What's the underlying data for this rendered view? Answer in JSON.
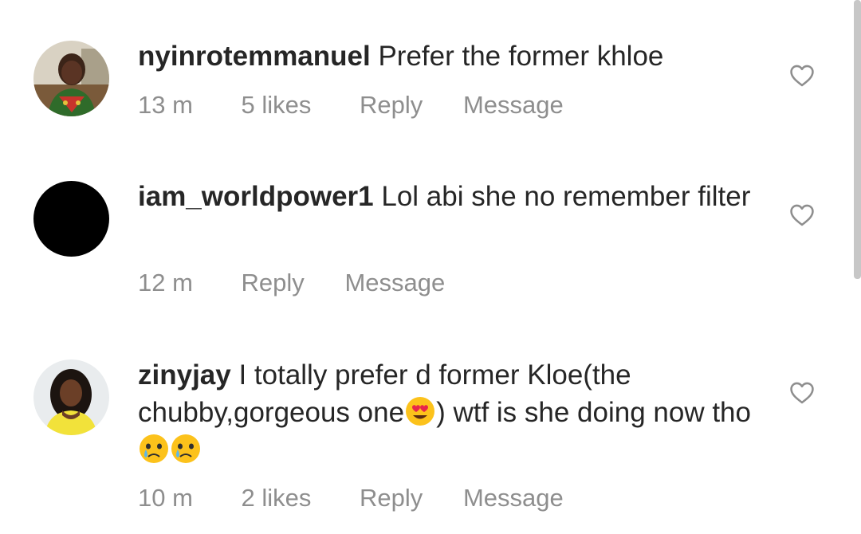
{
  "comments": [
    {
      "username": "nyinrotemmanuel",
      "text": " Prefer the former khloe",
      "time": "13 m",
      "likes": "5 likes",
      "reply": "Reply",
      "message": "Message",
      "avatar_icon": "profile-photo-woman"
    },
    {
      "username": "iam_worldpower1",
      "text": " Lol abi she no remember filter",
      "time": "12 m",
      "likes": "",
      "reply": "Reply",
      "message": "Message",
      "avatar_icon": "profile-photo-black"
    },
    {
      "username": "zinyjay",
      "text_part1": " I totally prefer d former Kloe(the chubby,gorgeous one",
      "text_part2": ") wtf is she doing now tho",
      "emoji_1": "heart-eyes-emoji",
      "emoji_2": "crying-emoji",
      "time": "10 m",
      "likes": "2 likes",
      "reply": "Reply",
      "message": "Message",
      "avatar_icon": "profile-photo-woman-yellow"
    }
  ],
  "icons": {
    "like": "heart-outline-icon"
  },
  "colors": {
    "primary_text": "#262626",
    "secondary_text": "#8e8e8e",
    "background": "#ffffff"
  }
}
